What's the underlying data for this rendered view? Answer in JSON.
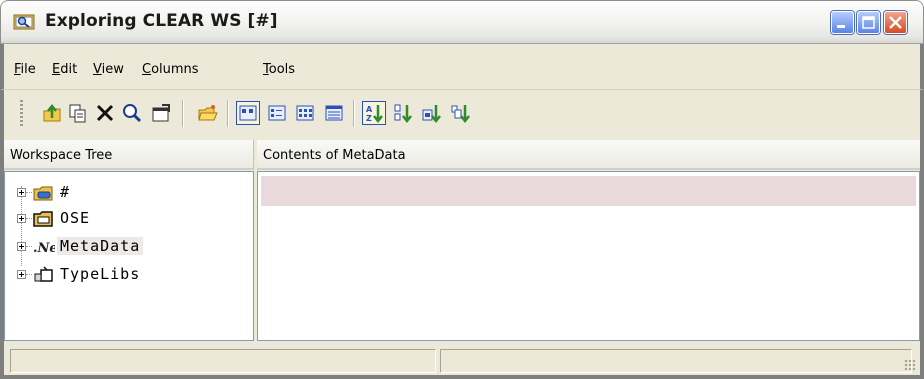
{
  "window": {
    "title": "Exploring CLEAR WS [#]",
    "icon": "explore-magnifier-icon",
    "caption_buttons": [
      "minimize-icon",
      "maximize-icon",
      "close-icon"
    ]
  },
  "menu": {
    "items": [
      {
        "label": "File",
        "mnemonic": "F"
      },
      {
        "label": "Edit",
        "mnemonic": "E"
      },
      {
        "label": "View",
        "mnemonic": "V"
      },
      {
        "label": "Columns",
        "mnemonic": "C"
      },
      {
        "label": "Tools",
        "mnemonic": "T"
      }
    ]
  },
  "toolbar": {
    "groups": [
      [
        "up-folder-icon",
        "copy-icon",
        "delete-x-icon",
        "find-icon",
        "properties-icon"
      ],
      [
        "open-folder-icon"
      ],
      [
        "view-large-icons-icon",
        "view-small-icons-icon",
        "view-list-icon",
        "view-details-icon"
      ],
      [
        "sort-az-icon",
        "sort-by-type-icon",
        "sort-by-size-icon",
        "sort-by-date-icon"
      ]
    ]
  },
  "panes": {
    "tree_header": "Workspace Tree",
    "content_header": "Contents of MetaData"
  },
  "tree": {
    "items": [
      {
        "label": "#",
        "icon": "root-folder-icon"
      },
      {
        "label": "OSE",
        "icon": "ose-folder-icon"
      },
      {
        "label": "MetaData",
        "icon": "net-metadata-icon",
        "selected": true
      },
      {
        "label": "TypeLibs",
        "icon": "typelibs-icon"
      }
    ]
  },
  "colors": {
    "window_bg": "#ece9d8",
    "selection_row": "#ead9dc",
    "pane_border": "#7f9db9",
    "close_button": "#d74a24",
    "caption_button": "#5a83e7"
  }
}
